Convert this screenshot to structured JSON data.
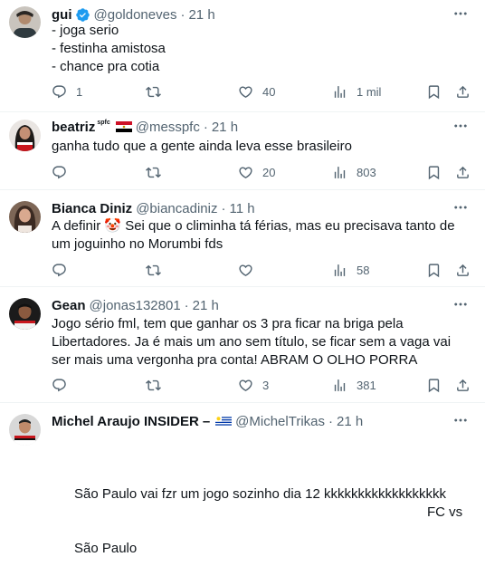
{
  "tweets": [
    {
      "name": "gui",
      "verified": true,
      "handle": "@goldoneves",
      "time": "21 h",
      "text": "- joga serio\n- festinha amistosa\n- chance pra cotia",
      "replies": "1",
      "retweets": "",
      "likes": "40",
      "views": "1 mil"
    },
    {
      "name": "beatriz",
      "name_suffix": "spfc",
      "handle": "@messpfc",
      "time": "21 h",
      "text": "ganha tudo que a gente ainda leva esse brasileiro",
      "replies": "",
      "retweets": "",
      "likes": "20",
      "views": "803"
    },
    {
      "name": "Bianca Diniz",
      "handle": "@biancadiniz",
      "time": "11 h",
      "text": "A definir 🤡 Sei que o climinha tá férias, mas eu precisava tanto de um joguinho no Morumbi fds",
      "replies": "",
      "retweets": "",
      "likes": "",
      "views": "58"
    },
    {
      "name": "Gean",
      "handle": "@jonas132801",
      "time": "21 h",
      "text": "Jogo sério fml, tem que ganhar os 3 pra ficar na briga pela Libertadores. Ja é mais um ano sem título, se ficar sem a vaga vai ser mais uma vergonha pra conta! ABRAM O OLHO PORRA",
      "replies": "",
      "retweets": "",
      "likes": "3",
      "views": "381"
    },
    {
      "name": "Michel Araujo INSIDER",
      "name_suffix": "–",
      "handle": "@MichelTrikas",
      "time": "21 h",
      "text_line1": "São Paulo vai fzr um jogo sozinho dia 12 kkkkkkkkkkkkkkkkkk",
      "text_fc": "FC vs",
      "text_line2": "São Paulo"
    }
  ],
  "colors": {
    "text": "#0f1419",
    "secondary": "#536471",
    "verified": "#1d9bf0",
    "border": "#eff3f4"
  },
  "icons": [
    "more-icon",
    "reply-icon",
    "retweet-icon",
    "like-icon",
    "views-icon",
    "bookmark-icon",
    "share-icon",
    "verified-icon",
    "egypt-flag-icon",
    "uruguay-flag-icon"
  ]
}
